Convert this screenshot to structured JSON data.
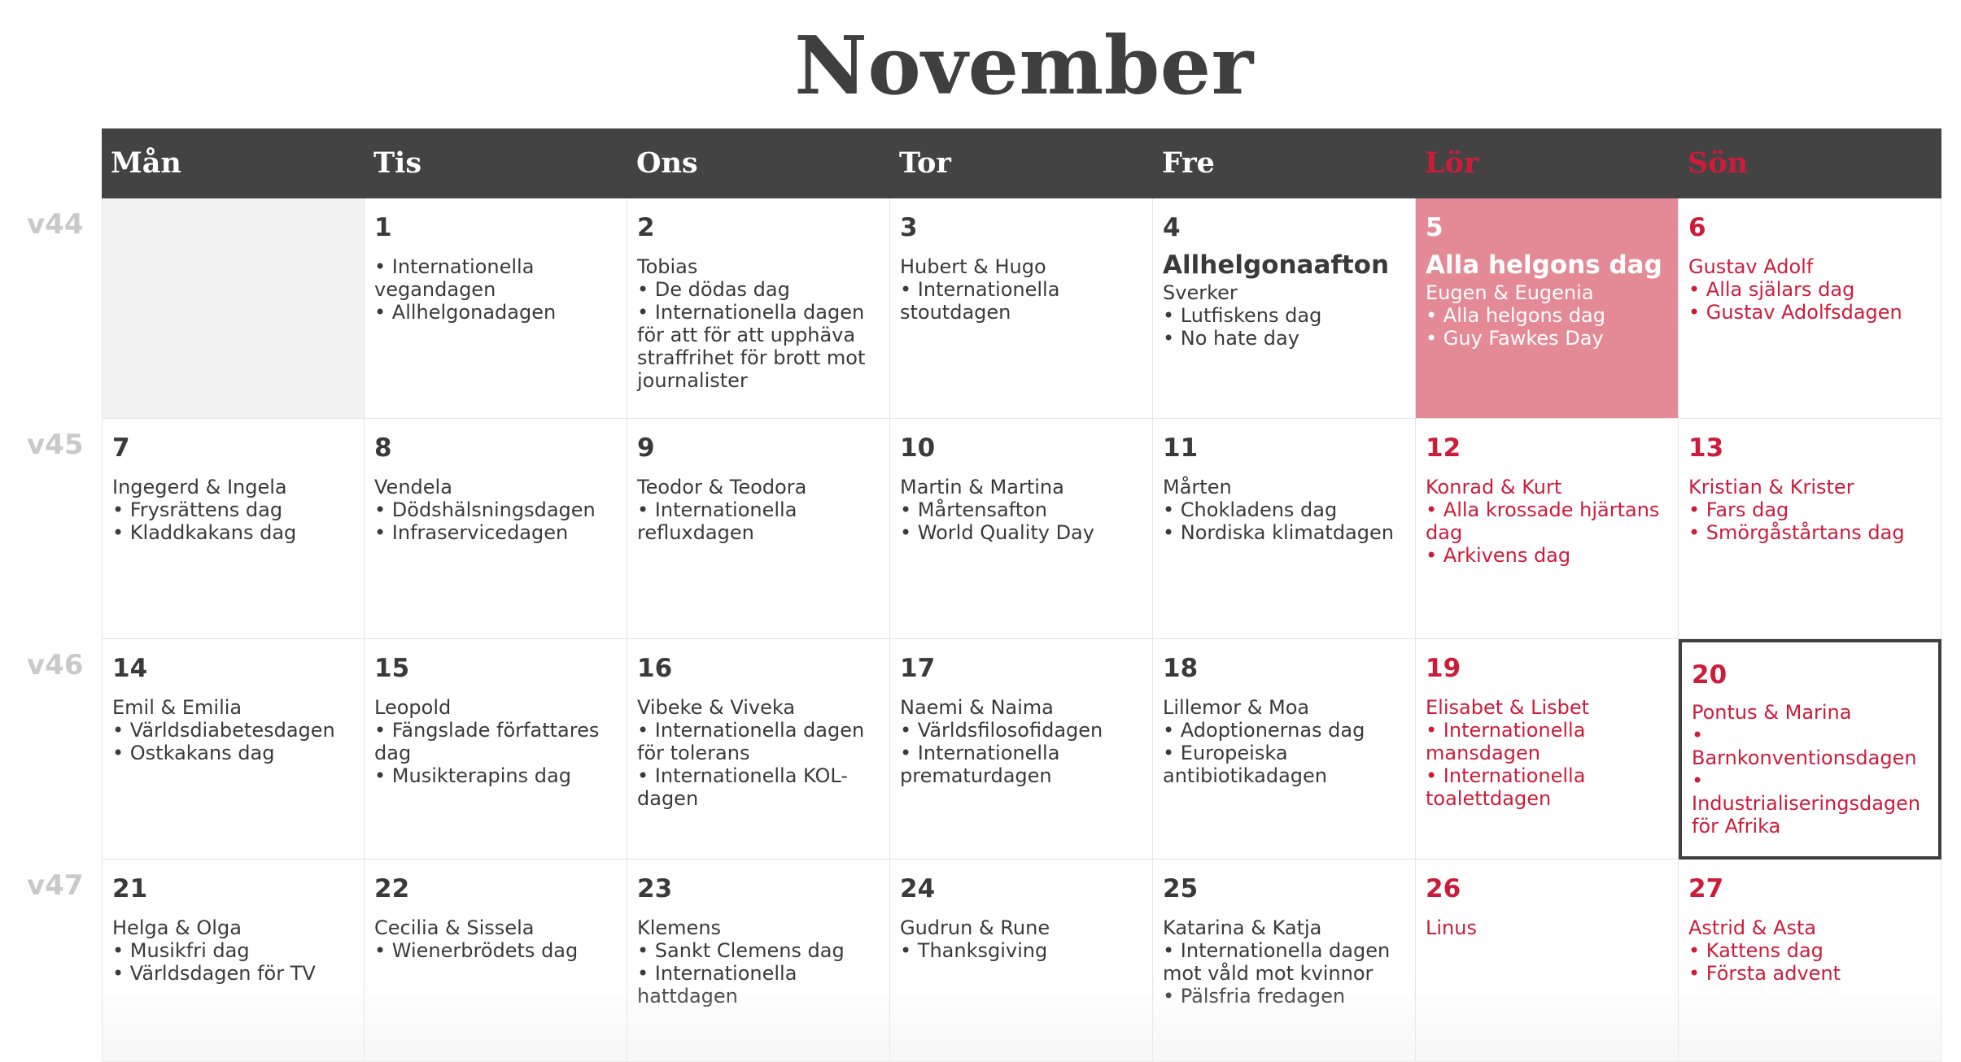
{
  "month": "November",
  "weekdays": [
    {
      "label": "Mån",
      "red": false
    },
    {
      "label": "Tis",
      "red": false
    },
    {
      "label": "Ons",
      "red": false
    },
    {
      "label": "Tor",
      "red": false
    },
    {
      "label": "Fre",
      "red": false
    },
    {
      "label": "Lör",
      "red": true
    },
    {
      "label": "Sön",
      "red": true
    }
  ],
  "weeks": [
    {
      "label": "v44",
      "days": [
        {
          "empty": true
        },
        {
          "day": "1",
          "lines": [
            "• Internationella vegandagen",
            "• Allhelgonadagen"
          ]
        },
        {
          "day": "2",
          "lines": [
            "Tobias",
            "• De dödas dag",
            "• Internationella dagen för att för att upphäva straf­frihet för brott mot journalister"
          ]
        },
        {
          "day": "3",
          "lines": [
            "Hubert & Hugo",
            "• Internationella stoutdagen"
          ]
        },
        {
          "day": "4",
          "special": "Allhelgonaafton",
          "lines": [
            "Sverker",
            "• Lutfiskens dag",
            "• No hate day"
          ]
        },
        {
          "day": "5",
          "red": true,
          "holiday": true,
          "special": "Alla helgons dag",
          "lines": [
            "Eugen & Eugenia",
            "• Alla helgons dag",
            "• Guy Fawkes Day"
          ]
        },
        {
          "day": "6",
          "red": true,
          "lines": [
            "Gustav Adolf",
            "• Alla själars dag",
            "• Gustav Adolfsdagen"
          ]
        }
      ]
    },
    {
      "label": "v45",
      "days": [
        {
          "day": "7",
          "lines": [
            "Ingegerd & Ingela",
            "• Frysrättens dag",
            "• Kladdkakans dag"
          ]
        },
        {
          "day": "8",
          "lines": [
            "Vendela",
            "• Dödshälsningsdagen",
            "• Infraservicedagen"
          ]
        },
        {
          "day": "9",
          "lines": [
            "Teodor & Teodora",
            "• Internationella refluxdagen"
          ]
        },
        {
          "day": "10",
          "lines": [
            "Martin & Martina",
            "• Mårtensafton",
            "• World Quality Day"
          ]
        },
        {
          "day": "11",
          "lines": [
            "Mårten",
            "• Chokladens dag",
            "• Nordiska klimatdagen"
          ]
        },
        {
          "day": "12",
          "red": true,
          "lines": [
            "Konrad & Kurt",
            "• Alla krossade hjärtans dag",
            "• Arkivens dag"
          ]
        },
        {
          "day": "13",
          "red": true,
          "lines": [
            "Kristian & Krister",
            "• Fars dag",
            "• Smörgåstårtans dag"
          ]
        }
      ]
    },
    {
      "label": "v46",
      "days": [
        {
          "day": "14",
          "lines": [
            "Emil & Emilia",
            "• Världsdiabetesdagen",
            "• Ostkakans dag"
          ]
        },
        {
          "day": "15",
          "lines": [
            "Leopold",
            "• Fängslade författares dag",
            "• Musikterapins dag"
          ]
        },
        {
          "day": "16",
          "lines": [
            "Vibeke & Viveka",
            "• Internationella dagen för tolerans",
            "• Internationella KOL-dagen"
          ]
        },
        {
          "day": "17",
          "lines": [
            "Naemi & Naima",
            "• Världsfilosofidagen",
            "• Internationella prematurdagen"
          ]
        },
        {
          "day": "18",
          "lines": [
            "Lillemor & Moa",
            "• Adoptionernas dag",
            "• Europeiska antibiotikadagen"
          ]
        },
        {
          "day": "19",
          "red": true,
          "lines": [
            "Elisabet & Lisbet",
            "• Internationella mansdagen",
            "• Internationella toalettdagen"
          ]
        },
        {
          "day": "20",
          "red": true,
          "today": true,
          "lines": [
            "Pontus & Marina",
            "• Barnkonventionsdagen",
            "• Industrialiseringsdagen för Afrika"
          ]
        }
      ]
    },
    {
      "label": "v47",
      "days": [
        {
          "day": "21",
          "lines": [
            "Helga & Olga",
            "• Musikfri dag",
            "• Världsdagen för TV"
          ]
        },
        {
          "day": "22",
          "lines": [
            "Cecilia & Sissela",
            "• Wienerbrödets dag"
          ]
        },
        {
          "day": "23",
          "lines": [
            "Klemens",
            "• Sankt Clemens dag",
            "• Internationella hattdagen"
          ]
        },
        {
          "day": "24",
          "lines": [
            "Gudrun & Rune",
            "• Thanksgiving"
          ]
        },
        {
          "day": "25",
          "lines": [
            "Katarina & Katja",
            "• Internationella dagen mot våld mot kvinnor",
            "• Pälsfria fredagen"
          ]
        },
        {
          "day": "26",
          "red": true,
          "lines": [
            "Linus"
          ]
        },
        {
          "day": "27",
          "red": true,
          "lines": [
            "Astrid & Asta",
            "• Kattens dag",
            "• Första advent"
          ]
        }
      ]
    }
  ],
  "colors": {
    "header_bg": "#434343",
    "weekend_red": "#cd1c3a",
    "holiday_bg": "#e48a96",
    "week_label": "#c9c9c9"
  }
}
